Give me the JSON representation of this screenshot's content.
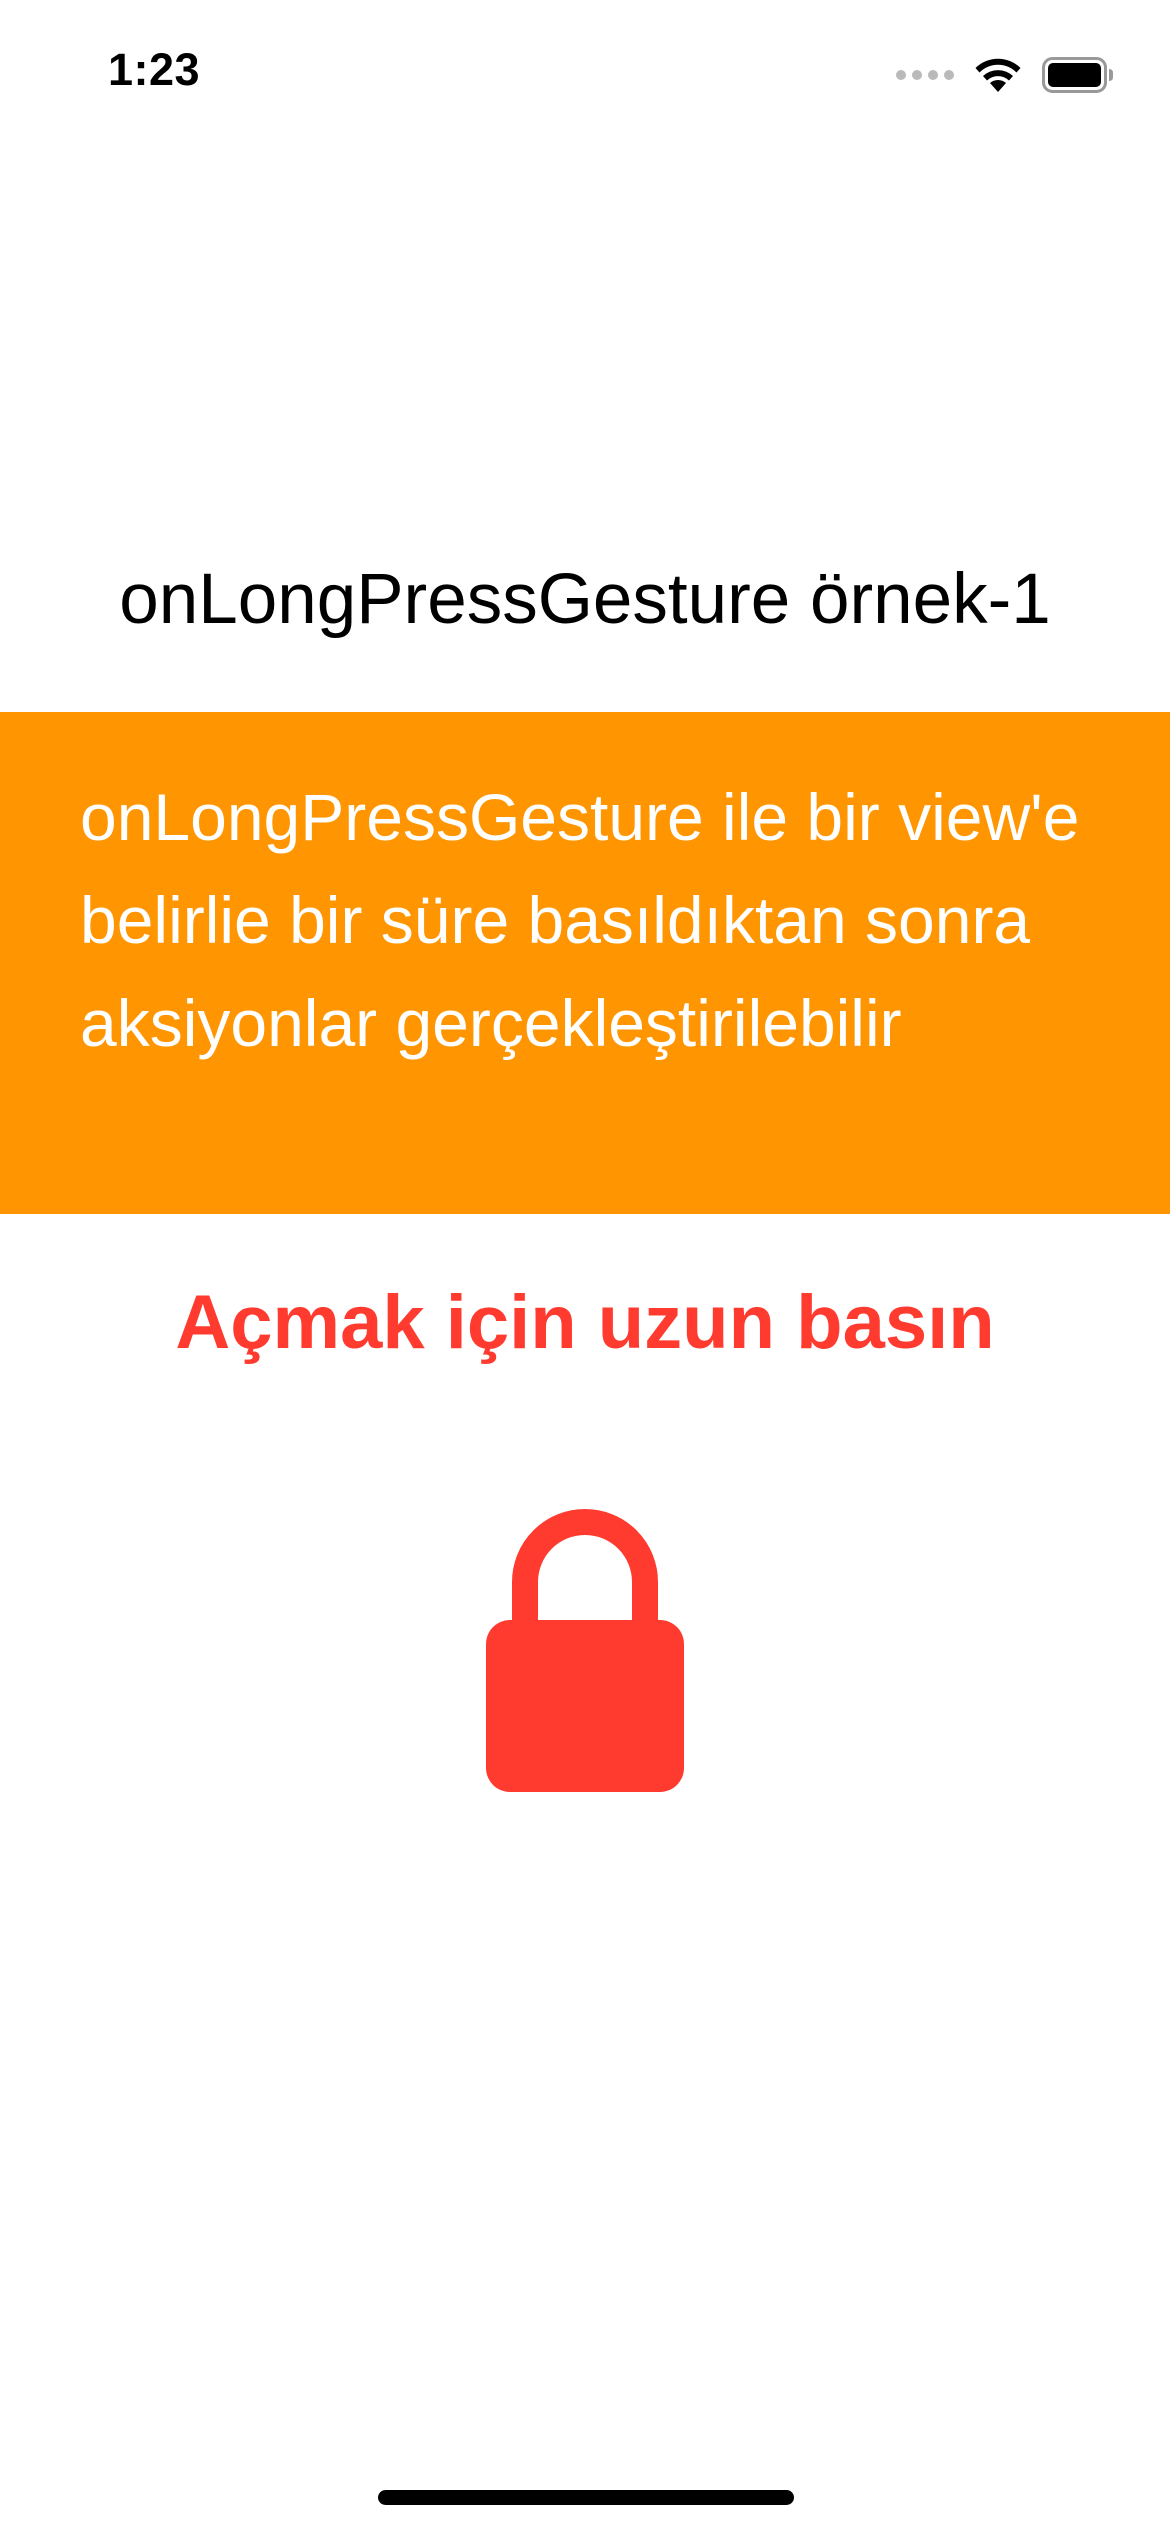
{
  "status_bar": {
    "time": "1:23",
    "icons": [
      "cellular-signal-icon",
      "wifi-icon",
      "battery-icon"
    ]
  },
  "screen": {
    "title": "onLongPressGesture örnek-1",
    "description": "onLongPressGesture ile bir view'e belirlie bir süre basıldıktan sonra aksiyonlar gerçekleştirilebilir",
    "instruction": "Açmak için uzun basın",
    "lock_icon": "lock-closed-icon"
  },
  "colors": {
    "background": "#ffffff",
    "description_background": "#ff9500",
    "description_text": "#ffffff",
    "accent_red": "#ff3b30",
    "title_text": "#000000"
  }
}
